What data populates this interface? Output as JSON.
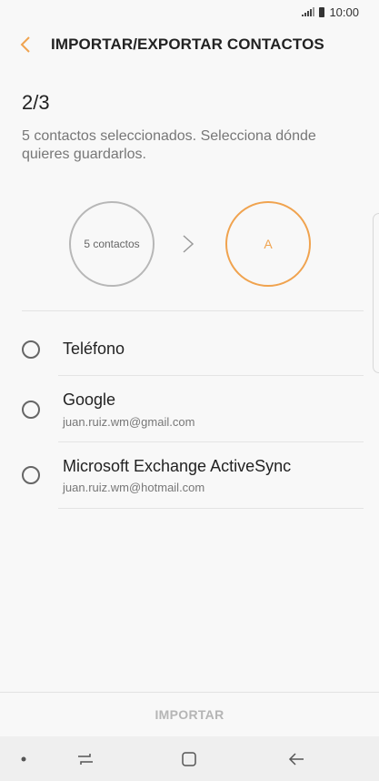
{
  "status_bar": {
    "time": "10:00"
  },
  "header": {
    "title": "IMPORTAR/EXPORTAR CONTACTOS"
  },
  "step": {
    "counter": "2/3",
    "description": "5 contactos seleccionados. Selecciona dónde quieres guardarlos."
  },
  "flow": {
    "source_label": "5 contactos",
    "target_label": "A"
  },
  "options": [
    {
      "title": "Teléfono",
      "subtitle": ""
    },
    {
      "title": "Google",
      "subtitle": "juan.ruiz.wm@gmail.com"
    },
    {
      "title": "Microsoft Exchange ActiveSync",
      "subtitle": "juan.ruiz.wm@hotmail.com"
    }
  ],
  "footer": {
    "import_label": "IMPORTAR"
  },
  "colors": {
    "accent": "#f0a34f",
    "disabled": "#b5b5b5",
    "background": "#f8f8f8"
  },
  "icons": [
    "signal-icon",
    "battery-icon",
    "back-arrow-icon",
    "chevron-right-icon",
    "nav-dot-icon",
    "recent-apps-icon",
    "home-icon",
    "back-icon"
  ]
}
